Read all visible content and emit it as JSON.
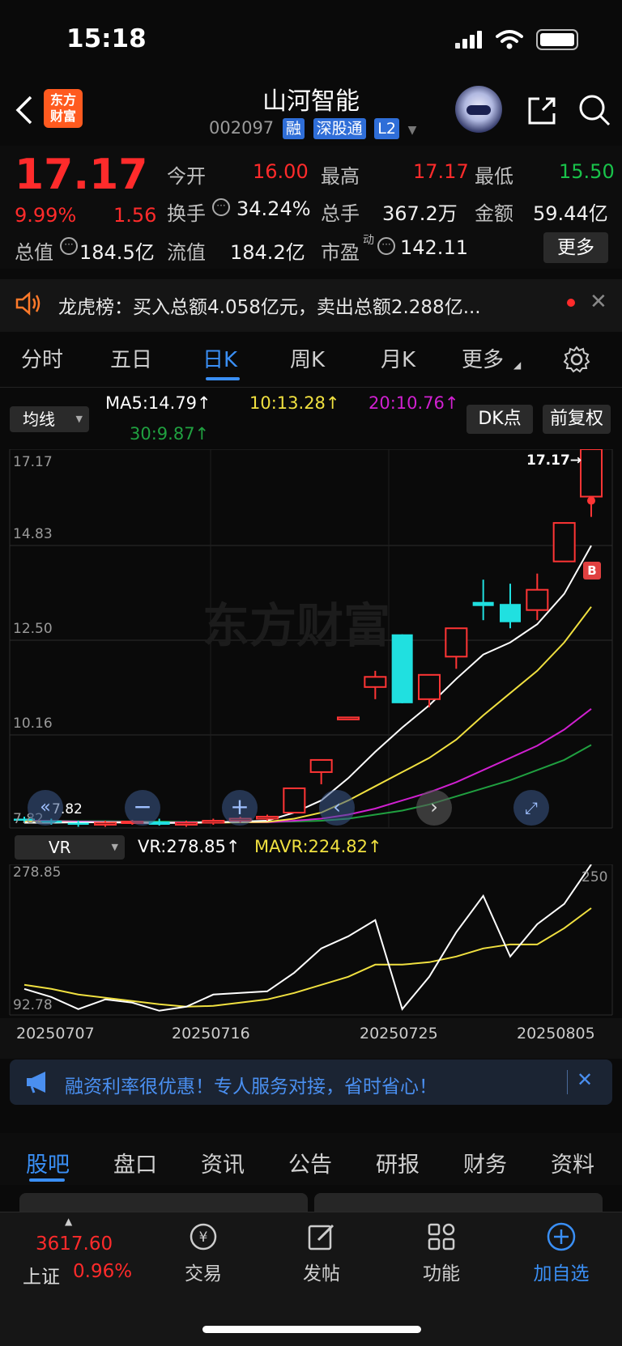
{
  "status": {
    "time": "15:18"
  },
  "header": {
    "logo_text_1": "东方",
    "logo_text_2": "财富",
    "name": "山河智能",
    "code": "002097",
    "tags": [
      "融",
      "深股通",
      "L2"
    ]
  },
  "quote": {
    "price": "17.17",
    "change_pct": "9.99%",
    "change": "1.56",
    "open_label": "今开",
    "open": "16.00",
    "high_label": "最高",
    "high": "17.17",
    "low_label": "最低",
    "low": "15.50",
    "turnover_label": "换手",
    "turnover": "34.24%",
    "volume_label": "总手",
    "volume": "367.2万",
    "amount_label": "金额",
    "amount": "59.44亿",
    "mktcap_label": "总值",
    "mktcap": "184.5亿",
    "float_label": "流值",
    "float_cap": "184.2亿",
    "pe_label": "市盈",
    "pe_super": "动",
    "pe": "142.11",
    "more": "更多"
  },
  "notice": {
    "text": "龙虎榜：买入总额4.058亿元，卖出总额2.288亿..."
  },
  "tabs": [
    "分时",
    "五日",
    "日K",
    "周K",
    "月K",
    "更多"
  ],
  "ma": {
    "selector": "均线",
    "ma5": "MA5:14.79↑",
    "ma10": "10:13.28↑",
    "ma20": "20:10.76↑",
    "ma30": "30:9.87↑",
    "dk_button": "DK点",
    "adjust_button": "前复权",
    "colors": {
      "ma5": "#ffffff",
      "ma10": "#f0e040",
      "ma20": "#d020d0",
      "ma30": "#20a040"
    }
  },
  "price_axis": [
    "17.17",
    "14.83",
    "12.50",
    "10.16",
    "7.82"
  ],
  "price_tags": {
    "high_marker": "17.17→",
    "low_marker": "7.82",
    "buy_marker": "B",
    "watermark": "东方财富"
  },
  "vr": {
    "selector": "VR",
    "vr": "VR:278.85↑",
    "mavr": "MAVR:224.82↑",
    "axis_top": "278.85",
    "axis_bottom": "92.78",
    "right_value": "250"
  },
  "dates": [
    "20250707",
    "20250716",
    "20250725",
    "20250805"
  ],
  "chart_data": {
    "type": "candlestick",
    "ylim": [
      7.82,
      17.17
    ],
    "candles": [
      {
        "o": 8.05,
        "c": 8.0,
        "h": 8.1,
        "l": 7.95
      },
      {
        "o": 8.0,
        "c": 7.95,
        "h": 8.05,
        "l": 7.9
      },
      {
        "o": 7.95,
        "c": 7.9,
        "h": 8.0,
        "l": 7.85
      },
      {
        "o": 7.9,
        "c": 7.95,
        "h": 8.0,
        "l": 7.85
      },
      {
        "o": 7.95,
        "c": 7.98,
        "h": 8.02,
        "l": 7.9
      },
      {
        "o": 7.98,
        "c": 7.9,
        "h": 8.05,
        "l": 7.88
      },
      {
        "o": 7.9,
        "c": 7.95,
        "h": 8.0,
        "l": 7.85
      },
      {
        "o": 7.95,
        "c": 8.0,
        "h": 8.05,
        "l": 7.9
      },
      {
        "o": 8.0,
        "c": 8.05,
        "h": 8.1,
        "l": 7.95
      },
      {
        "o": 8.05,
        "c": 8.1,
        "h": 8.15,
        "l": 8.0
      },
      {
        "o": 8.2,
        "c": 8.8,
        "h": 8.8,
        "l": 8.2
      },
      {
        "o": 9.2,
        "c": 9.5,
        "h": 9.5,
        "l": 8.9
      },
      {
        "o": 10.5,
        "c": 10.55,
        "h": 10.55,
        "l": 10.5
      },
      {
        "o": 11.3,
        "c": 11.55,
        "h": 11.7,
        "l": 11.0
      },
      {
        "o": 12.6,
        "c": 10.9,
        "h": 12.6,
        "l": 10.9
      },
      {
        "o": 11.0,
        "c": 11.6,
        "h": 11.6,
        "l": 10.8
      },
      {
        "o": 12.05,
        "c": 12.75,
        "h": 12.75,
        "l": 11.75
      },
      {
        "o": 13.4,
        "c": 13.3,
        "h": 13.95,
        "l": 12.95
      },
      {
        "o": 13.35,
        "c": 12.9,
        "h": 13.85,
        "l": 12.75
      },
      {
        "o": 13.2,
        "c": 13.7,
        "h": 14.1,
        "l": 12.95
      },
      {
        "o": 14.4,
        "c": 15.35,
        "h": 15.35,
        "l": 14.4
      },
      {
        "o": 16.0,
        "c": 17.17,
        "h": 17.17,
        "l": 15.5
      }
    ],
    "ma5": [
      7.95,
      7.95,
      7.96,
      7.96,
      7.95,
      7.94,
      7.95,
      7.96,
      7.98,
      8.0,
      8.2,
      8.5,
      9.05,
      9.7,
      10.3,
      10.85,
      11.5,
      12.1,
      12.4,
      12.85,
      13.6,
      14.79
    ],
    "ma10": [
      7.98,
      7.97,
      7.96,
      7.96,
      7.96,
      7.95,
      7.95,
      7.95,
      7.96,
      7.97,
      8.05,
      8.2,
      8.5,
      8.85,
      9.2,
      9.55,
      10.0,
      10.6,
      11.15,
      11.7,
      12.4,
      13.28
    ],
    "ma20": [
      8.0,
      7.99,
      7.98,
      7.97,
      7.97,
      7.96,
      7.96,
      7.96,
      7.96,
      7.96,
      8.0,
      8.05,
      8.15,
      8.3,
      8.5,
      8.7,
      8.95,
      9.25,
      9.55,
      9.85,
      10.25,
      10.76
    ],
    "ma30": [
      8.0,
      8.0,
      7.99,
      7.99,
      7.98,
      7.98,
      7.97,
      7.97,
      7.97,
      7.97,
      7.98,
      8.0,
      8.05,
      8.15,
      8.25,
      8.4,
      8.6,
      8.8,
      9.0,
      9.25,
      9.5,
      9.87
    ],
    "vr_series": [
      125,
      115,
      100,
      112,
      108,
      98,
      103,
      118,
      120,
      122,
      145,
      175,
      190,
      210,
      100,
      140,
      195,
      240,
      165,
      205,
      230,
      278.85
    ],
    "mavr_series": [
      130,
      125,
      118,
      114,
      110,
      106,
      103,
      104,
      108,
      112,
      120,
      130,
      140,
      155,
      155,
      158,
      165,
      175,
      180,
      180,
      200,
      224.82
    ],
    "vr_ylim": [
      92.78,
      278.85
    ]
  },
  "promo": {
    "text": "融资利率很优惠！专人服务对接，省时省心！"
  },
  "bottom_tabs": [
    "股吧",
    "盘口",
    "资讯",
    "公告",
    "研报",
    "财务",
    "资料"
  ],
  "bottom_nav": {
    "index_value": "3617.60",
    "index_name": "上证",
    "index_change": "0.96%",
    "trade": "交易",
    "post": "发帖",
    "functions": "功能",
    "add_watch": "加自选"
  }
}
